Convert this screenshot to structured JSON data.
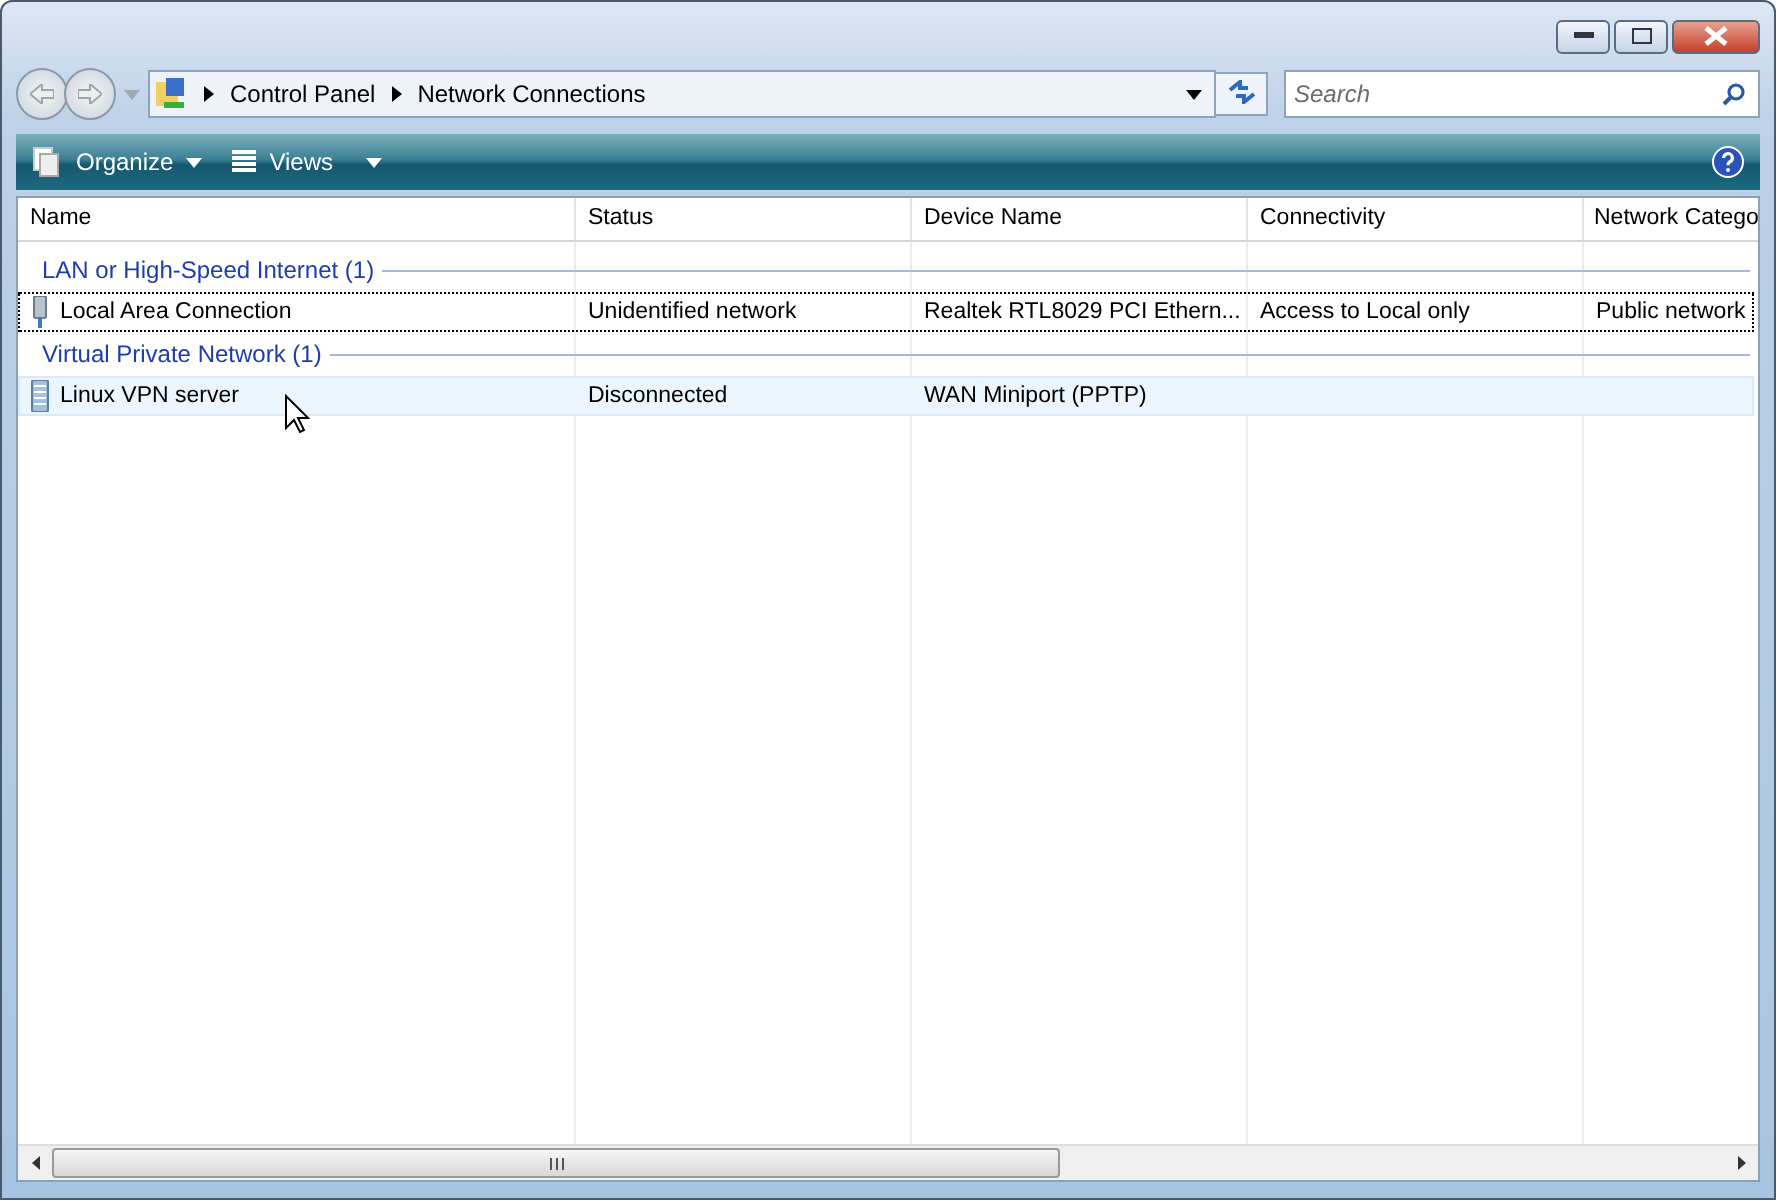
{
  "breadcrumb": [
    "Control Panel",
    "Network Connections"
  ],
  "search": {
    "placeholder": "Search"
  },
  "toolbar": [
    {
      "label": "Organize",
      "kind": "organize"
    },
    {
      "label": "Views",
      "kind": "views"
    }
  ],
  "columns": [
    "Name",
    "Status",
    "Device Name",
    "Connectivity",
    "Network Catego"
  ],
  "groups": [
    {
      "title": "LAN or High-Speed Internet (1)",
      "rows": [
        {
          "kind": "lan",
          "cells": [
            "Local Area Connection",
            "Unidentified network",
            "Realtek RTL8029 PCI Ethern...",
            "Access to Local only",
            "Public network"
          ],
          "focused": true,
          "hovered": false
        }
      ]
    },
    {
      "title": "Virtual Private Network (1)",
      "rows": [
        {
          "kind": "vpn",
          "cells": [
            "Linux VPN server",
            "Disconnected",
            "WAN Miniport (PPTP)",
            "",
            ""
          ],
          "focused": false,
          "hovered": true
        }
      ]
    }
  ]
}
